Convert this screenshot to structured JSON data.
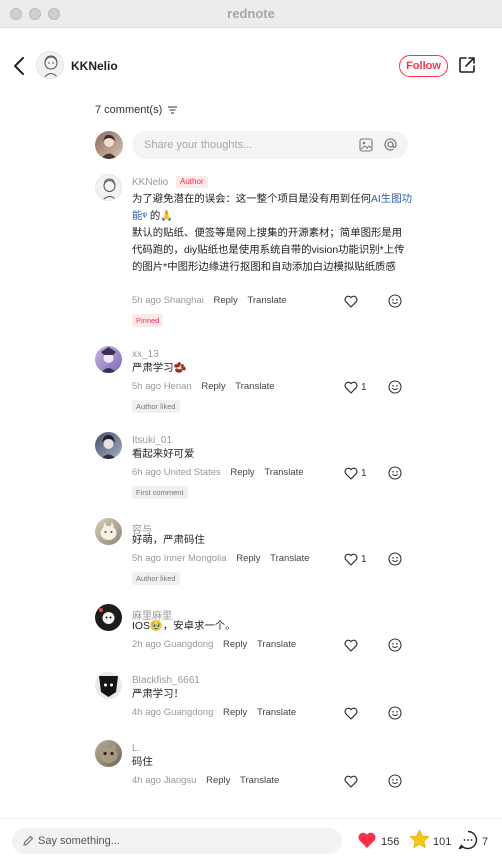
{
  "window": {
    "title": "rednote"
  },
  "header": {
    "username": "KKNelio",
    "follow_label": "Follow"
  },
  "comments_header": {
    "count_label": "7 comment(s)"
  },
  "composer": {
    "placeholder": "Share your thoughts..."
  },
  "comments": [
    {
      "user": "KKNelio",
      "badge": "Author",
      "text_lines": [
        "为了避免潜在的误会：这一整个项目是没有用到任何",
        "AI生图功能",
        "的🙏",
        "默认的贴纸、便签等是网上搜集的开源素材；简单图形是用代码跑的，diy贴纸也是使用系统自带的vision功能识别*上传的图片*中图形边缘进行抠图和自动添加白边模拟贴纸质感"
      ],
      "time": "5h ago",
      "location": "Shanghai",
      "reply": "Reply",
      "translate": "Translate",
      "tag": "Pinned",
      "likes": ""
    },
    {
      "user": "xx_13",
      "text": "严肃学习🫘",
      "time": "5h ago",
      "location": "Henan",
      "reply": "Reply",
      "translate": "Translate",
      "tag": "Author liked",
      "likes": "1"
    },
    {
      "user": "Itsuki_01",
      "text": "看起来好可爱",
      "time": "6h ago",
      "location": "United States",
      "reply": "Reply",
      "translate": "Translate",
      "tag": "First comment",
      "likes": "1"
    },
    {
      "user": "容与",
      "text": "好萌，严肃码住",
      "time": "5h ago",
      "location": "Inner Mongolia",
      "reply": "Reply",
      "translate": "Translate",
      "tag": "Author liked",
      "likes": "1"
    },
    {
      "user": "麻里麻里",
      "text": "IOS🥹，安卓求一个。",
      "time": "2h ago",
      "location": "Guangdong",
      "reply": "Reply",
      "translate": "Translate",
      "likes": ""
    },
    {
      "user": "Blackfish_6661",
      "text": "严肃学习！",
      "time": "4h ago",
      "location": "Guangdong",
      "reply": "Reply",
      "translate": "Translate",
      "likes": ""
    },
    {
      "user": "L.",
      "text": "码住",
      "time": "4h ago",
      "location": "Jiangsu",
      "reply": "Reply",
      "translate": "Translate",
      "likes": ""
    }
  ],
  "bottom_bar": {
    "placeholder": "Say something...",
    "likes": "156",
    "stars": "101",
    "comments": "7"
  },
  "colors": {
    "accent": "#ff2e4d",
    "link": "#2a5fa8",
    "star": "#f5c518"
  }
}
